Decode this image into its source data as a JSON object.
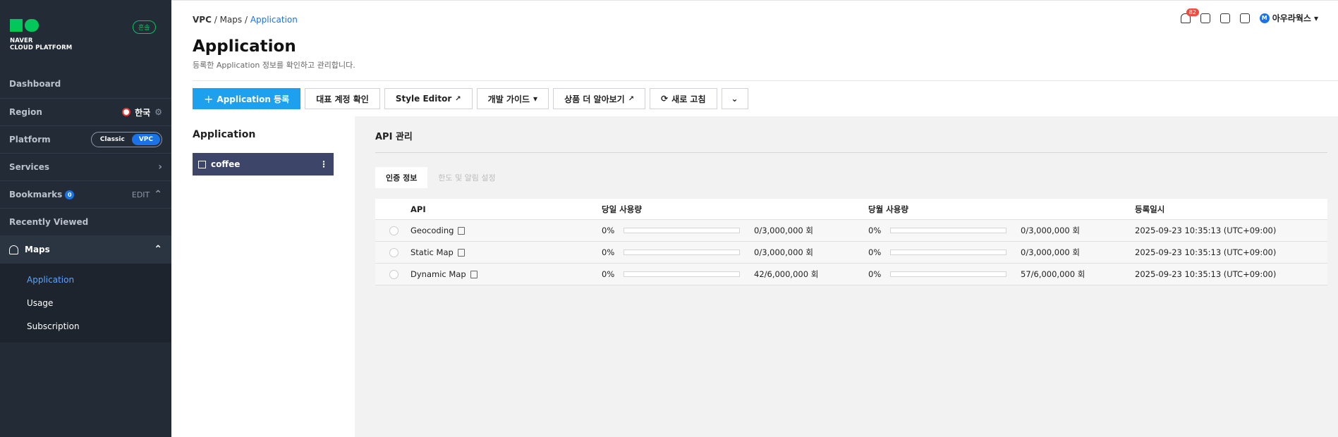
{
  "sidebar": {
    "logo_text": [
      "NAVER",
      "CLOUD PLATFORM"
    ],
    "theme_badge": "흔솔",
    "dashboard": "Dashboard",
    "region": {
      "label": "Region",
      "value": "한국"
    },
    "platform": {
      "label": "Platform",
      "options": [
        "Classic",
        "VPC"
      ],
      "selected": "VPC"
    },
    "services": "Services",
    "bookmarks": {
      "label": "Bookmarks",
      "count": "0",
      "edit": "EDIT"
    },
    "recently_viewed": "Recently Viewed",
    "maps": {
      "label": "Maps",
      "items": [
        "Application",
        "Usage",
        "Subscription"
      ],
      "active": "Application"
    }
  },
  "header": {
    "breadcrumb": [
      "VPC",
      "Maps",
      "Application"
    ],
    "title": "Application",
    "description": "등록한 Application 정보를 확인하고 관리합니다.",
    "notification_count": "82",
    "user": {
      "initial": "M",
      "name": "아우라웍스"
    }
  },
  "toolbar": {
    "register": "Application 등록",
    "rep_account": "대표 계정 확인",
    "style_editor": "Style Editor",
    "dev_guide": "개발 가이드",
    "more_products": "상품 더 알아보기",
    "refresh": "새로 고침"
  },
  "left_panel": {
    "title": "Application",
    "apps": [
      {
        "name": "coffee"
      }
    ]
  },
  "api_panel": {
    "title": "API 관리",
    "tabs": [
      "인증 정보",
      "한도 및 알림 설정"
    ],
    "active_tab": "인증 정보",
    "columns": [
      "API",
      "당일 사용량",
      "당월 사용량",
      "등록일시"
    ],
    "rows": [
      {
        "api": "Geocoding",
        "daily_pct": "0%",
        "daily": "0/3,000,000 회",
        "monthly_pct": "0%",
        "monthly": "0/3,000,000 회",
        "date": "2025-09-23 10:35:13 (UTC+09:00)"
      },
      {
        "api": "Static Map",
        "daily_pct": "0%",
        "daily": "0/3,000,000 회",
        "monthly_pct": "0%",
        "monthly": "0/3,000,000 회",
        "date": "2025-09-23 10:35:13 (UTC+09:00)"
      },
      {
        "api": "Dynamic Map",
        "daily_pct": "0%",
        "daily": "42/6,000,000 회",
        "monthly_pct": "0%",
        "monthly": "57/6,000,000 회",
        "date": "2025-09-23 10:35:13 (UTC+09:00)"
      }
    ]
  }
}
